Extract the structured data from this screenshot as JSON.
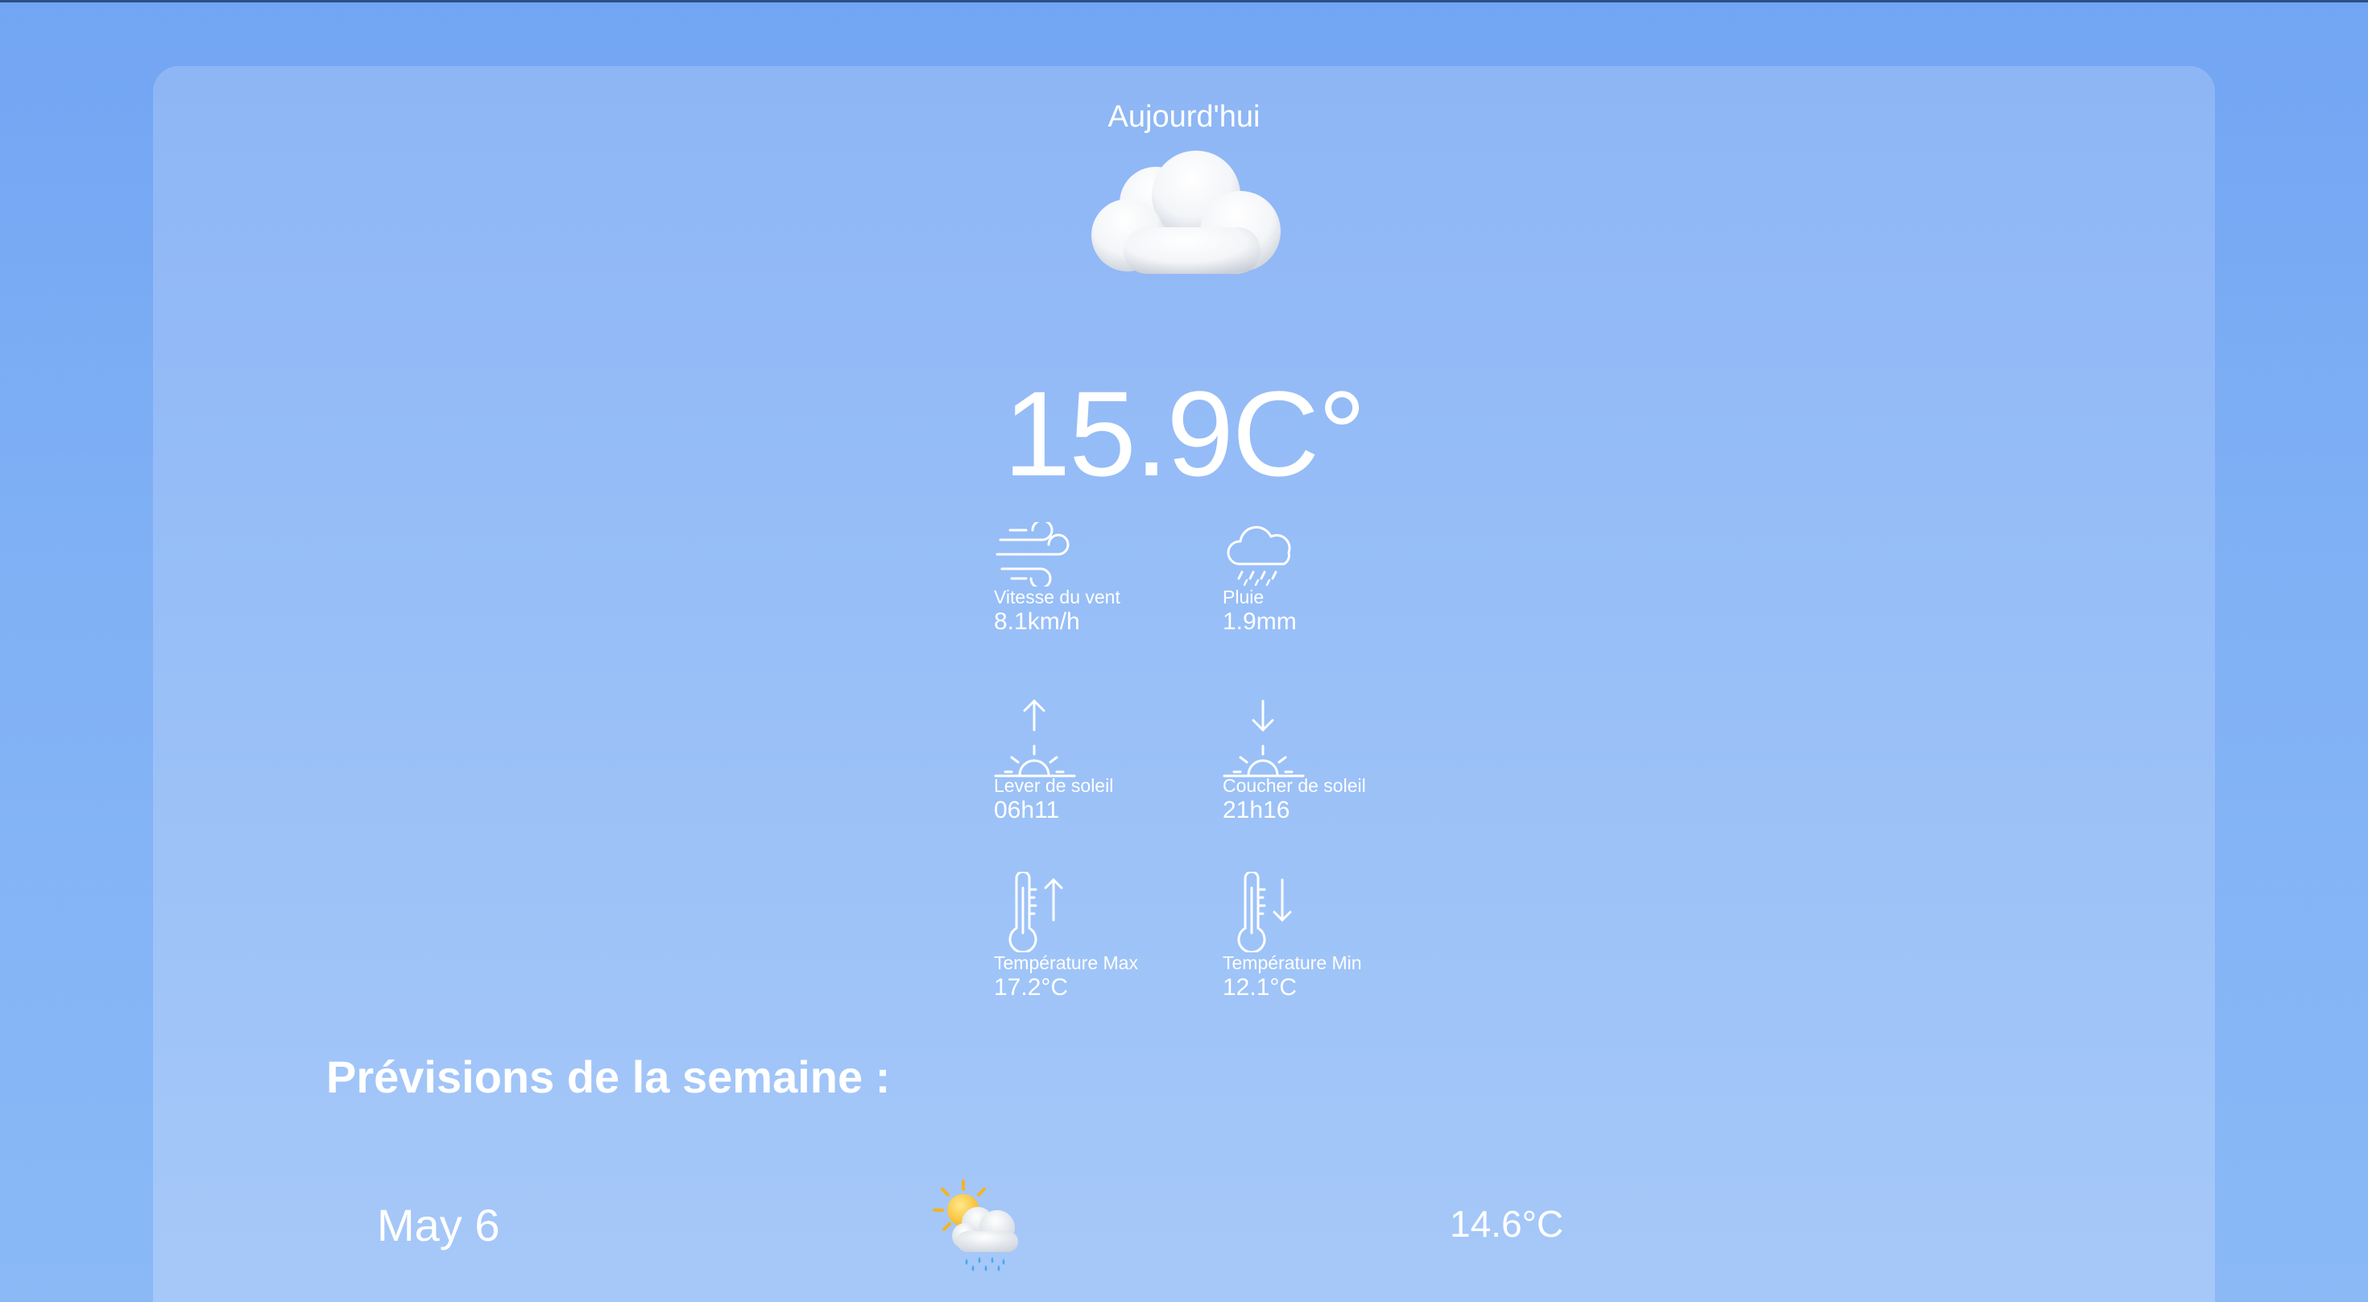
{
  "colors": {
    "page_background": "#72a5f3",
    "card_background": "#98bff7",
    "text": "#ffffff"
  },
  "today": {
    "label": "Aujourd'hui",
    "weather_icon": "cloud-icon",
    "temperature": "15.9C°"
  },
  "stats": {
    "wind": {
      "icon": "wind-icon",
      "label": "Vitesse du vent",
      "value": "8.1km/h"
    },
    "rain": {
      "icon": "rain-cloud-icon",
      "label": "Pluie",
      "value": "1.9mm"
    },
    "sunrise": {
      "icon": "sunrise-icon",
      "label": "Lever de soleil",
      "value": "06h11"
    },
    "sunset": {
      "icon": "sunset-icon",
      "label": "Coucher de soleil",
      "value": "21h16"
    },
    "temp_max": {
      "icon": "thermometer-up-icon",
      "label": "Température Max",
      "value": "17.2°C"
    },
    "temp_min": {
      "icon": "thermometer-down-icon",
      "label": "Température Min",
      "value": "12.1°C"
    }
  },
  "week": {
    "title": "Prévisions de la semaine :",
    "days": [
      {
        "date": "May 6",
        "icon": "sun-behind-rain-cloud-icon",
        "temperature": "14.6°C"
      }
    ]
  }
}
